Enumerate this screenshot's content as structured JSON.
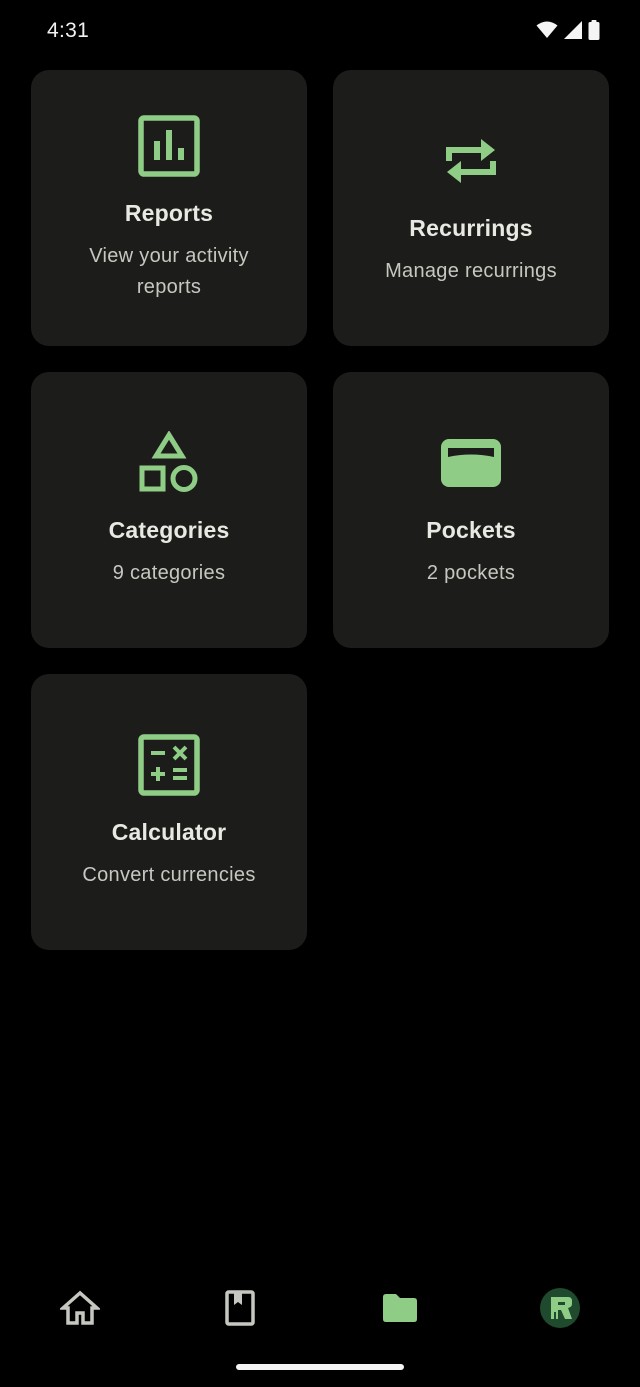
{
  "status_bar": {
    "time": "4:31",
    "icons": [
      "wifi-icon",
      "signal-icon",
      "battery-icon"
    ]
  },
  "colors": {
    "background": "#000000",
    "card": "#1c1d1a",
    "accent": "#8fcd86",
    "nav_inactive": "#c5c7c0"
  },
  "cards": [
    {
      "icon": "bar-chart-icon",
      "title": "Reports",
      "subtitle": "View your activity reports"
    },
    {
      "icon": "repeat-icon",
      "title": "Recurrings",
      "subtitle": "Manage recurrings"
    },
    {
      "icon": "shapes-icon",
      "title": "Categories",
      "subtitle": "9 categories"
    },
    {
      "icon": "wallet-icon",
      "title": "Pockets",
      "subtitle": "2 pockets"
    },
    {
      "icon": "calculator-icon",
      "title": "Calculator",
      "subtitle": "Convert currencies"
    }
  ],
  "bottom_nav": {
    "items": [
      {
        "icon": "home-icon",
        "selected": false
      },
      {
        "icon": "bookmark-book-icon",
        "selected": false
      },
      {
        "icon": "folder-icon",
        "selected": true
      },
      {
        "icon": "profile-avatar-icon",
        "selected": false
      }
    ]
  }
}
